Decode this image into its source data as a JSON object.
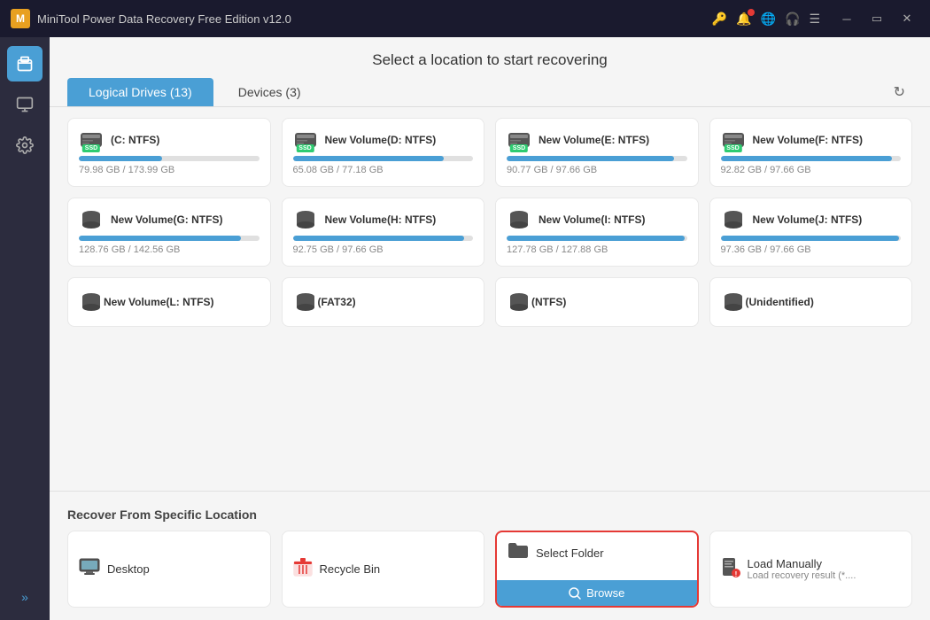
{
  "titlebar": {
    "logo_text": "M",
    "title": "MiniTool Power Data Recovery Free Edition v12.0",
    "controls": [
      "minimize",
      "maximize",
      "close"
    ]
  },
  "sidebar": {
    "items": [
      {
        "id": "home",
        "icon": "🖥",
        "active": true
      },
      {
        "id": "tools",
        "icon": "🧰",
        "active": false
      },
      {
        "id": "settings",
        "icon": "⚙",
        "active": false
      }
    ],
    "expand_label": "»"
  },
  "page_header": "Select a location to start recovering",
  "tabs": [
    {
      "label": "Logical Drives (13)",
      "active": true
    },
    {
      "label": "Devices (3)",
      "active": false
    }
  ],
  "drives": [
    {
      "name": "(C: NTFS)",
      "has_ssd": true,
      "used_pct": 46,
      "size": "79.98 GB / 173.99 GB"
    },
    {
      "name": "New Volume(D: NTFS)",
      "has_ssd": true,
      "used_pct": 84,
      "size": "65.08 GB / 77.18 GB"
    },
    {
      "name": "New Volume(E: NTFS)",
      "has_ssd": true,
      "used_pct": 94,
      "size": "90.77 GB / 97.66 GB"
    },
    {
      "name": "New Volume(F: NTFS)",
      "has_ssd": true,
      "used_pct": 95,
      "size": "92.82 GB / 97.66 GB"
    },
    {
      "name": "New Volume(G: NTFS)",
      "has_ssd": false,
      "used_pct": 90,
      "size": "128.76 GB / 142.56 GB"
    },
    {
      "name": "New Volume(H: NTFS)",
      "has_ssd": false,
      "used_pct": 95,
      "size": "92.75 GB / 97.66 GB"
    },
    {
      "name": "New Volume(I: NTFS)",
      "has_ssd": false,
      "used_pct": 99,
      "size": "127.78 GB / 127.88 GB"
    },
    {
      "name": "New Volume(J: NTFS)",
      "has_ssd": false,
      "used_pct": 99,
      "size": "97.36 GB / 97.66 GB"
    }
  ],
  "no_storage_drives": [
    {
      "name": "New Volume(L: NTFS)"
    },
    {
      "name": "(FAT32)"
    },
    {
      "name": "(NTFS)"
    },
    {
      "name": "(Unidentified)"
    }
  ],
  "specific_section_title": "Recover From Specific Location",
  "specific_locations": [
    {
      "id": "desktop",
      "icon": "🖥",
      "label": "Desktop",
      "sublabel": ""
    },
    {
      "id": "recycle",
      "icon": "🗑",
      "label": "Recycle Bin",
      "sublabel": ""
    },
    {
      "id": "select_folder",
      "label": "Select Folder",
      "browse_label": "Browse"
    },
    {
      "id": "load_manually",
      "icon": "📄",
      "label": "Load Manually",
      "sublabel": "Load recovery result (*...."
    }
  ]
}
